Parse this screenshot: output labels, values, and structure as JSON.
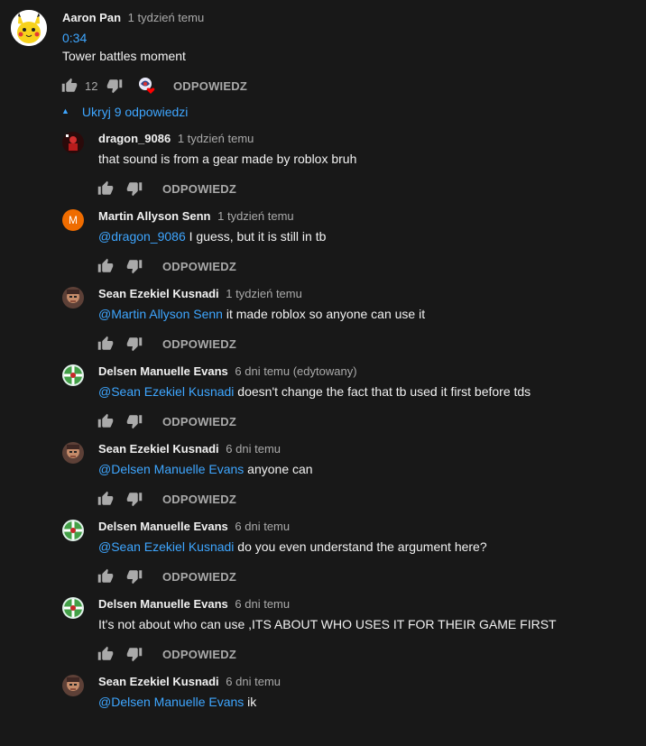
{
  "top_comment": {
    "author": "Aaron Pan",
    "time": "1 tydzień temu",
    "timestamp_link": "0:34",
    "text": "Tower battles moment",
    "likes": "12",
    "reply_label": "ODPOWIEDZ"
  },
  "replies_toggle": {
    "label": "Ukryj 9 odpowiedzi",
    "icon": "caret-up-icon"
  },
  "replies": [
    {
      "author": "dragon_9086",
      "time": "1 tydzień temu",
      "mention": "",
      "text": "that sound is from a gear made by roblox bruh",
      "reply_label": "ODPOWIEDZ",
      "avatar": "red-figure"
    },
    {
      "author": "Martin Allyson Senn",
      "time": "1 tydzień temu",
      "mention": "@dragon_9086",
      "text": " I guess, but it is still in tb",
      "reply_label": "ODPOWIEDZ",
      "avatar": "letter",
      "avatar_letter": "M",
      "avatar_color": "#ef6c00"
    },
    {
      "author": "Sean Ezekiel Kusnadi",
      "time": "1 tydzień temu",
      "mention": "@Martin Allyson Senn",
      "text": " it made roblox so anyone can use it",
      "reply_label": "ODPOWIEDZ",
      "avatar": "face"
    },
    {
      "author": "Delsen Manuelle Evans",
      "time": "6 dni temu (edytowany)",
      "mention": "@Sean Ezekiel Kusnadi",
      "text": " doesn't change the fact that tb used it first before tds",
      "reply_label": "ODPOWIEDZ",
      "avatar": "globe"
    },
    {
      "author": "Sean Ezekiel Kusnadi",
      "time": "6 dni temu",
      "mention": "@Delsen Manuelle Evans",
      "text": " anyone can",
      "reply_label": "ODPOWIEDZ",
      "avatar": "face"
    },
    {
      "author": "Delsen Manuelle Evans",
      "time": "6 dni temu",
      "mention": "@Sean Ezekiel Kusnadi",
      "text": " do you even understand the argument here?",
      "reply_label": "ODPOWIEDZ",
      "avatar": "globe"
    },
    {
      "author": "Delsen Manuelle Evans",
      "time": "6 dni temu",
      "mention": "",
      "text": "It's not about who can use ,ITS ABOUT WHO USES IT FOR THEIR GAME FIRST",
      "reply_label": "ODPOWIEDZ",
      "avatar": "globe"
    },
    {
      "author": "Sean Ezekiel Kusnadi",
      "time": "6 dni temu",
      "mention": "@Delsen Manuelle Evans",
      "text": " ik",
      "reply_label": "",
      "avatar": "face"
    }
  ],
  "colors": {
    "background": "#181818",
    "link": "#3ea6ff",
    "secondary_text": "#aaaaaa",
    "heart": "#ff0000"
  }
}
